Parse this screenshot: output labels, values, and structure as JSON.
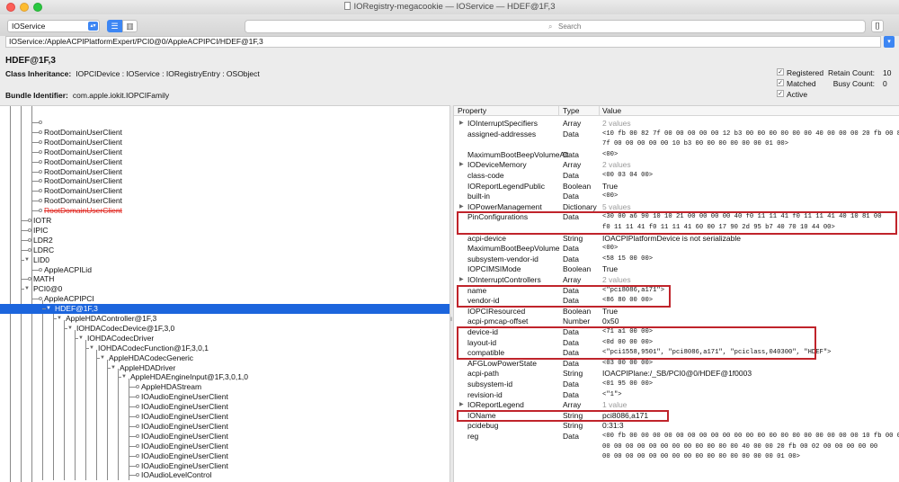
{
  "window": {
    "title": "IORegistry-megacookie — IOService — HDEF@1F,3"
  },
  "toolbar": {
    "service": "IOService",
    "search_placeholder": "Search",
    "list_view_icon": "list-icon",
    "column_view_icon": "columns-icon"
  },
  "path": "IOService:/AppleACPIPlatformExpert/PCI0@0/AppleACPIPCI/HDEF@1F,3",
  "info": {
    "object_name": "HDEF@1F,3",
    "class_inheritance_label": "Class Inheritance:",
    "class_inheritance": "IOPCIDevice : IOService : IORegistryEntry : OSObject",
    "bundle_identifier_label": "Bundle Identifier:",
    "bundle_identifier": "com.apple.iokit.IOPCIFamily",
    "checks": [
      {
        "label": "Registered",
        "checked": true
      },
      {
        "label": "Matched",
        "checked": true
      },
      {
        "label": "Active",
        "checked": true
      }
    ],
    "retain_count_label": "Retain Count:",
    "retain_count": "10",
    "busy_count_label": "Busy Count:",
    "busy_count": "0"
  },
  "tree": [
    {
      "label": "",
      "depth": 3
    },
    {
      "label": "RootDomainUserClient",
      "depth": 3
    },
    {
      "label": "RootDomainUserClient",
      "depth": 3
    },
    {
      "label": "RootDomainUserClient",
      "depth": 3
    },
    {
      "label": "RootDomainUserClient",
      "depth": 3
    },
    {
      "label": "RootDomainUserClient",
      "depth": 3
    },
    {
      "label": "RootDomainUserClient",
      "depth": 3
    },
    {
      "label": "RootDomainUserClient",
      "depth": 3
    },
    {
      "label": "RootDomainUserClient",
      "depth": 3
    },
    {
      "label": "RootDomainUserClient",
      "depth": 3,
      "strike": true
    },
    {
      "label": "IOTR",
      "depth": 2
    },
    {
      "label": "IPIC",
      "depth": 2
    },
    {
      "label": "LDR2",
      "depth": 2
    },
    {
      "label": "LDRC",
      "depth": 2
    },
    {
      "label": "LID0",
      "depth": 2,
      "expander": true
    },
    {
      "label": "AppleACPILid",
      "depth": 3
    },
    {
      "label": "MATH",
      "depth": 2
    },
    {
      "label": "PCI0@0",
      "depth": 2,
      "expander": true
    },
    {
      "label": "AppleACPIPCI",
      "depth": 3,
      "expander": false
    },
    {
      "label": "HDEF@1F,3",
      "depth": 4,
      "expander": true,
      "selected": true
    },
    {
      "label": "AppleHDAController@1F,3",
      "depth": 5,
      "expander": true
    },
    {
      "label": "IOHDACodecDevice@1F,3,0",
      "depth": 6,
      "expander": true
    },
    {
      "label": "IOHDACodecDriver",
      "depth": 7,
      "expander": true
    },
    {
      "label": "IOHDACodecFunction@1F,3,0,1",
      "depth": 8,
      "expander": true
    },
    {
      "label": "AppleHDACodecGeneric",
      "depth": 9,
      "expander": true
    },
    {
      "label": "AppleHDADriver",
      "depth": 10,
      "expander": true
    },
    {
      "label": "AppleHDAEngineInput@1F,3,0,1,0",
      "depth": 11,
      "expander": true
    },
    {
      "label": "AppleHDAStream",
      "depth": 12
    },
    {
      "label": "IOAudioEngineUserClient",
      "depth": 12
    },
    {
      "label": "IOAudioEngineUserClient",
      "depth": 12
    },
    {
      "label": "IOAudioEngineUserClient",
      "depth": 12
    },
    {
      "label": "IOAudioEngineUserClient",
      "depth": 12
    },
    {
      "label": "IOAudioEngineUserClient",
      "depth": 12
    },
    {
      "label": "IOAudioEngineUserClient",
      "depth": 12
    },
    {
      "label": "IOAudioEngineUserClient",
      "depth": 12
    },
    {
      "label": "IOAudioEngineUserClient",
      "depth": 12
    },
    {
      "label": "IOAudioLevelControl",
      "depth": 12
    }
  ],
  "prop_header": {
    "property": "Property",
    "type": "Type",
    "value": "Value"
  },
  "properties": [
    {
      "name": "IOInterruptSpecifiers",
      "type": "Array",
      "value": "2 values",
      "gray": true,
      "expander": true
    },
    {
      "name": "assigned-addresses",
      "type": "Data",
      "value": "<10 fb 00 82 7f 00 00 00 00 00 12 b3 00 00 00 00 00 00 40 00 00 00 20 fb 00 82",
      "value2": "7f 00 00 00 00 00 10 b3 00 00 00 00 00 00 01 00>"
    },
    {
      "name": "MaximumBootBeepVolumeAlt",
      "type": "Data",
      "value": "<00>"
    },
    {
      "name": "IODeviceMemory",
      "type": "Array",
      "value": "2 values",
      "gray": true,
      "expander": true
    },
    {
      "name": "class-code",
      "type": "Data",
      "value": "<00 03 04 00>"
    },
    {
      "name": "IOReportLegendPublic",
      "type": "Boolean",
      "value": "True",
      "plain": true
    },
    {
      "name": "built-in",
      "type": "Data",
      "value": "<00>"
    },
    {
      "name": "IOPowerManagement",
      "type": "Dictionary",
      "value": "5 values",
      "gray": true,
      "expander": true
    },
    {
      "name": "PinConfigurations",
      "type": "Data",
      "value": "<30 00 a6 90 10 10 21 00 00 00 00 40 f0 11 11 41 f0 11 11 41 40 10 81 00",
      "value2": "f0 11 11 41 f0 11 11 41 60 00 17 90 2d 95 b7 40 70 10 44 00>"
    },
    {
      "name": "acpi-device",
      "type": "String",
      "value": "IOACPIPlatformDevice is not serializable",
      "plain": true
    },
    {
      "name": "MaximumBootBeepVolume",
      "type": "Data",
      "value": "<00>"
    },
    {
      "name": "subsystem-vendor-id",
      "type": "Data",
      "value": "<58 15 00 00>"
    },
    {
      "name": "IOPCIMSIMode",
      "type": "Boolean",
      "value": "True",
      "plain": true
    },
    {
      "name": "IOInterruptControllers",
      "type": "Array",
      "value": "2 values",
      "gray": true,
      "expander": true
    },
    {
      "name": "name",
      "type": "Data",
      "value": "<\"pci8086,a171\">"
    },
    {
      "name": "vendor-id",
      "type": "Data",
      "value": "<86 80 00 00>"
    },
    {
      "name": "IOPCIResourced",
      "type": "Boolean",
      "value": "True",
      "plain": true
    },
    {
      "name": "acpi-pmcap-offset",
      "type": "Number",
      "value": "0x50",
      "plain": true
    },
    {
      "name": "device-id",
      "type": "Data",
      "value": "<71 a1 00 00>"
    },
    {
      "name": "layout-id",
      "type": "Data",
      "value": "<0d 00 00 00>"
    },
    {
      "name": "compatible",
      "type": "Data",
      "value": "<\"pci1558,9501\", \"pci8086,a171\", \"pciclass,040300\", \"HDEF\">"
    },
    {
      "name": "AFGLowPowerState",
      "type": "Data",
      "value": "<03 00 00 00>"
    },
    {
      "name": "acpi-path",
      "type": "String",
      "value": "IOACPIPlane:/_SB/PCI0@0/HDEF@1f0003",
      "plain": true
    },
    {
      "name": "subsystem-id",
      "type": "Data",
      "value": "<01 95 00 00>"
    },
    {
      "name": "revision-id",
      "type": "Data",
      "value": "<\"1\">"
    },
    {
      "name": "IOReportLegend",
      "type": "Array",
      "value": "1 value",
      "gray": true,
      "expander": true
    },
    {
      "name": "IOName",
      "type": "String",
      "value": "pci8086,a171",
      "plain": true
    },
    {
      "name": "pcidebug",
      "type": "String",
      "value": "0:31:3",
      "plain": true
    },
    {
      "name": "reg",
      "type": "Data",
      "value": "<00 fb 00 00 00 00 00 00 00 00 00 00 00 00 00 00 00 00 00 00 00 00 10 fb 00 02",
      "value2": "00 00 00 00 00 00 00 00 00 00 00 00 40 00 00 20 fb 00 02 00 00 00 00 00",
      "value3": "00 00 00 00 00 00 00 00 00 00 00 00 00 00 00 01 00>"
    }
  ]
}
